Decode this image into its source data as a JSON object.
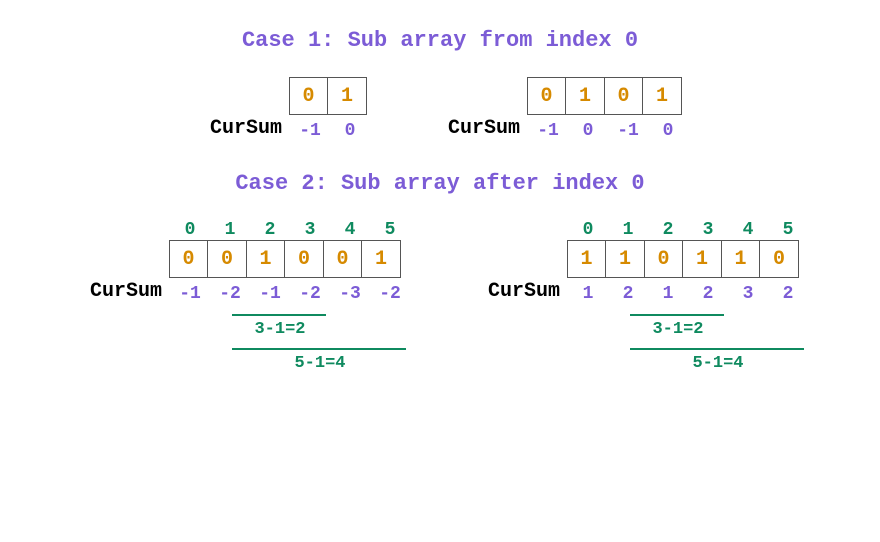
{
  "case1": {
    "title": "Case 1: Sub array from index 0",
    "sum_label": "CurSum",
    "ex1": {
      "cells": [
        "0",
        "1"
      ],
      "sums": [
        "-1",
        "0"
      ]
    },
    "ex2": {
      "cells": [
        "0",
        "1",
        "0",
        "1"
      ],
      "sums": [
        "-1",
        "0",
        "-1",
        "0"
      ]
    }
  },
  "case2": {
    "title": "Case 2: Sub array after index 0",
    "sum_label": "CurSum",
    "ex1": {
      "indices": [
        "0",
        "1",
        "2",
        "3",
        "4",
        "5"
      ],
      "cells": [
        "0",
        "0",
        "1",
        "0",
        "0",
        "1"
      ],
      "sums": [
        "-1",
        "-2",
        "-1",
        "-2",
        "-3",
        "-2"
      ],
      "brk1": "3-1=2",
      "brk2": "5-1=4"
    },
    "ex2": {
      "indices": [
        "0",
        "1",
        "2",
        "3",
        "4",
        "5"
      ],
      "cells": [
        "1",
        "1",
        "0",
        "1",
        "1",
        "0"
      ],
      "sums": [
        "1",
        "2",
        "1",
        "2",
        "3",
        "2"
      ],
      "brk1": "3-1=2",
      "brk2": "5-1=4"
    }
  }
}
